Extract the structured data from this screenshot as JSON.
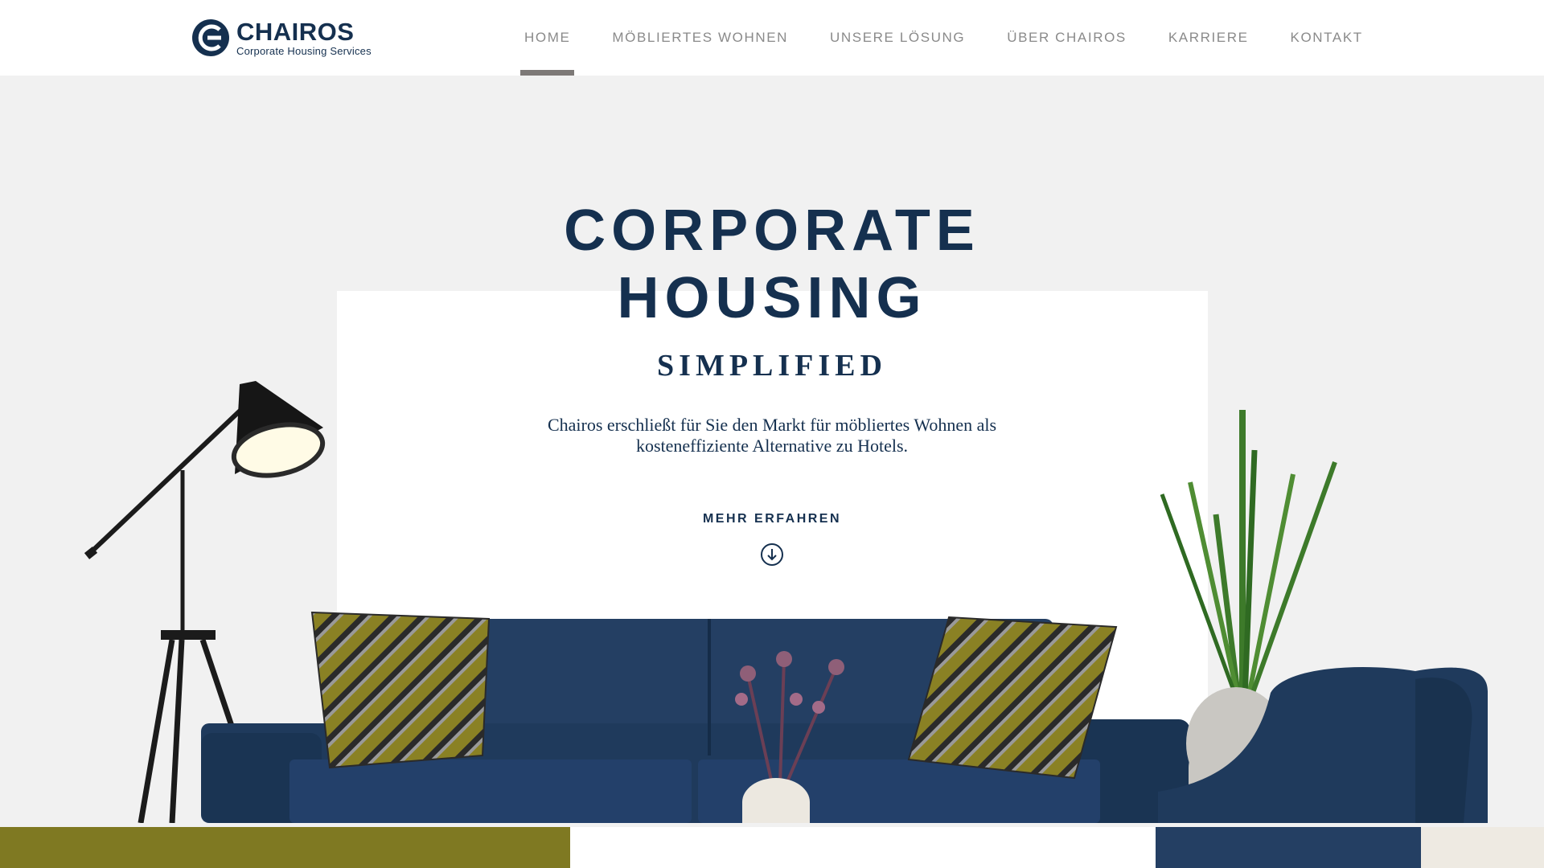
{
  "brand": {
    "name": "CHAIROS",
    "tagline": "Corporate Housing Services",
    "color": "#15304f"
  },
  "nav": {
    "items": [
      {
        "label": "HOME",
        "active": true
      },
      {
        "label": "MÖBLIERTES WOHNEN",
        "active": false
      },
      {
        "label": "UNSERE LÖSUNG",
        "active": false
      },
      {
        "label": "ÜBER CHAIROS",
        "active": false
      },
      {
        "label": "KARRIERE",
        "active": false
      },
      {
        "label": "KONTAKT",
        "active": false
      }
    ]
  },
  "hero": {
    "title_line1": "CORPORATE",
    "title_line2": "HOUSING",
    "subtitle": "SIMPLIFIED",
    "description": "Chairos erschließt für Sie den Markt für möbliertes Wohnen als kosteneffiziente Alternative zu Hotels.",
    "cta_label": "MEHR ERFAHREN",
    "cta_icon": "arrow-down-circle-icon"
  },
  "colors": {
    "accent_navy": "#15304f",
    "sofa": "#1f3a5c",
    "olive": "#7f7922",
    "background": "#f1f1f1"
  }
}
